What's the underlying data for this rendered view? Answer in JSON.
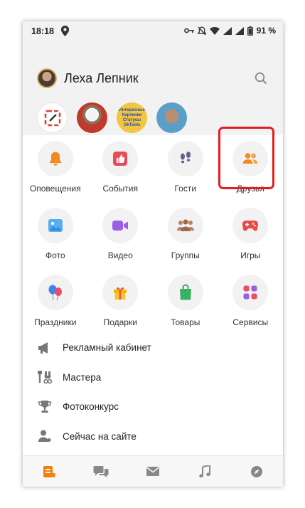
{
  "status_bar": {
    "time": "18:18",
    "battery_percent": "91 %"
  },
  "header": {
    "user_name": "Леха Лепник"
  },
  "stories": {
    "s3_text": "Интересные Картинки Статусы OkTools"
  },
  "grid": {
    "tiles": [
      {
        "label": "Оповещения",
        "icon": "bell-icon"
      },
      {
        "label": "События",
        "icon": "thumbs-up-icon"
      },
      {
        "label": "Гости",
        "icon": "footprints-icon"
      },
      {
        "label": "Друзья",
        "icon": "friends-icon"
      },
      {
        "label": "Фото",
        "icon": "photo-icon"
      },
      {
        "label": "Видео",
        "icon": "video-camera-icon"
      },
      {
        "label": "Группы",
        "icon": "groups-icon"
      },
      {
        "label": "Игры",
        "icon": "gamepad-icon"
      },
      {
        "label": "Праздники",
        "icon": "balloons-icon"
      },
      {
        "label": "Подарки",
        "icon": "gift-icon"
      },
      {
        "label": "Товары",
        "icon": "shopping-bag-icon"
      },
      {
        "label": "Сервисы",
        "icon": "services-grid-icon"
      }
    ]
  },
  "list": {
    "items": [
      {
        "label": "Рекламный кабинет",
        "icon": "megaphone-icon"
      },
      {
        "label": "Мастера",
        "icon": "tools-icon"
      },
      {
        "label": "Фотоконкурс",
        "icon": "trophy-icon"
      },
      {
        "label": "Сейчас на сайте",
        "icon": "user-online-icon"
      }
    ]
  },
  "colors": {
    "accent_orange": "#ee8208",
    "highlight_red": "#e02020",
    "icon_gray": "#777777"
  }
}
